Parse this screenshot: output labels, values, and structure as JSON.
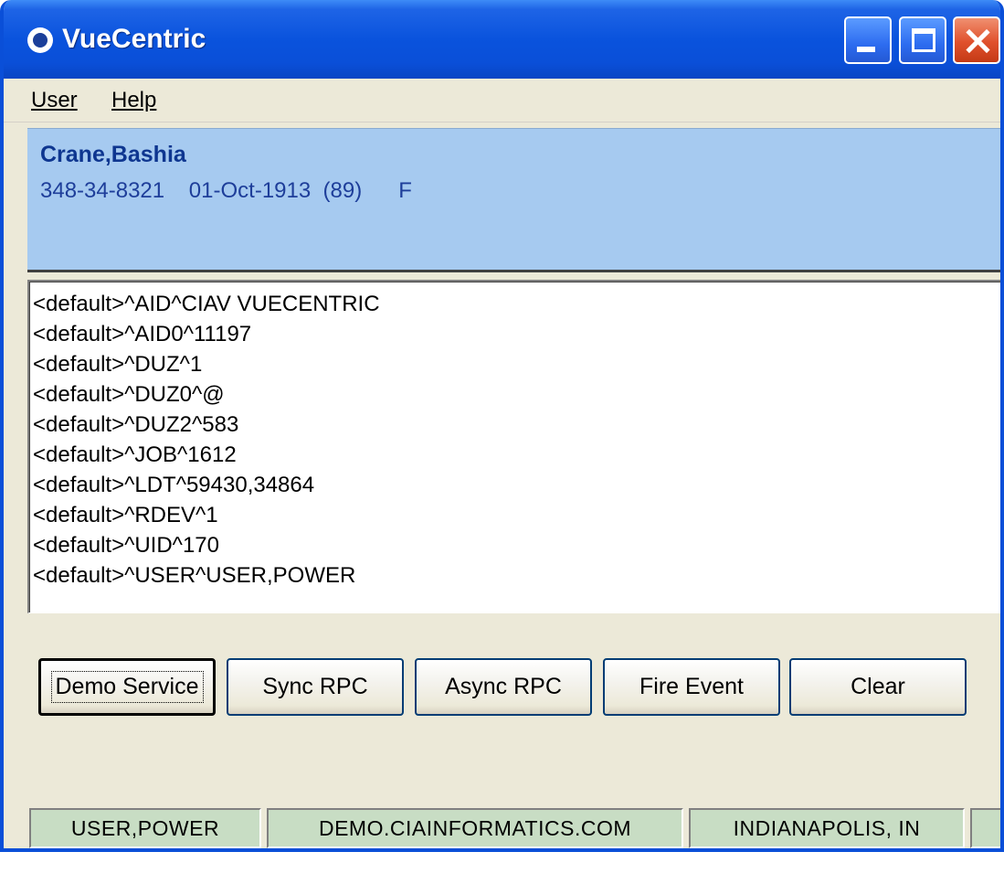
{
  "window": {
    "title": "VueCentric"
  },
  "menu": {
    "user_label": "User",
    "help_label": "Help"
  },
  "patient": {
    "name": "Crane,Bashia",
    "ssn": "348-34-8321",
    "dob": "01-Oct-1913",
    "age": "(89)",
    "sex": "F"
  },
  "log": {
    "lines": [
      "<default>^AID^CIAV VUECENTRIC",
      "<default>^AID0^11197",
      "<default>^DUZ^1",
      "<default>^DUZ0^@",
      "<default>^DUZ2^583",
      "<default>^JOB^1612",
      "<default>^LDT^59430,34864",
      "<default>^RDEV^1",
      "<default>^UID^170",
      "<default>^USER^USER,POWER"
    ]
  },
  "buttons": {
    "demo_service": "Demo Service",
    "sync_rpc": "Sync RPC",
    "async_rpc": "Async RPC",
    "fire_event": "Fire Event",
    "clear": "Clear"
  },
  "status": {
    "user": "USER,POWER",
    "server": "DEMO.CIAINFORMATICS.COM",
    "location": "INDIANAPOLIS, IN"
  },
  "colors": {
    "titlebar": "#0a4fd8",
    "patient_banner": "#a6caf0",
    "status_panel": "#c8ddc4",
    "window_face": "#ece9d8"
  }
}
